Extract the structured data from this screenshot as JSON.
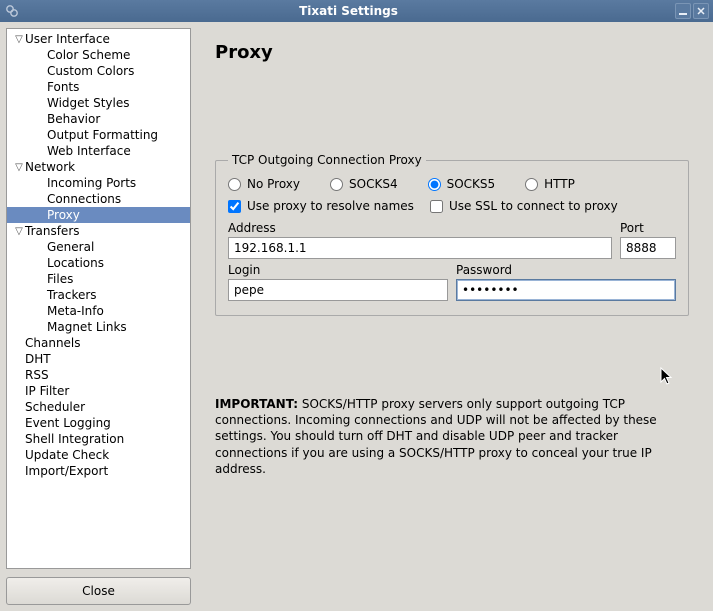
{
  "window": {
    "title": "Tixati Settings"
  },
  "sidebar": {
    "close_label": "Close",
    "items": [
      {
        "label": "User Interface",
        "depth": 0,
        "expander": "▽"
      },
      {
        "label": "Color Scheme",
        "depth": 1
      },
      {
        "label": "Custom Colors",
        "depth": 1
      },
      {
        "label": "Fonts",
        "depth": 1
      },
      {
        "label": "Widget Styles",
        "depth": 1
      },
      {
        "label": "Behavior",
        "depth": 1
      },
      {
        "label": "Output Formatting",
        "depth": 1
      },
      {
        "label": "Web Interface",
        "depth": 1
      },
      {
        "label": "Network",
        "depth": 0,
        "expander": "▽"
      },
      {
        "label": "Incoming Ports",
        "depth": 1
      },
      {
        "label": "Connections",
        "depth": 1
      },
      {
        "label": "Proxy",
        "depth": 1,
        "selected": true
      },
      {
        "label": "Transfers",
        "depth": 0,
        "expander": "▽"
      },
      {
        "label": "General",
        "depth": 1
      },
      {
        "label": "Locations",
        "depth": 1
      },
      {
        "label": "Files",
        "depth": 1
      },
      {
        "label": "Trackers",
        "depth": 1
      },
      {
        "label": "Meta-Info",
        "depth": 1
      },
      {
        "label": "Magnet Links",
        "depth": 1
      },
      {
        "label": "Channels",
        "depth": 0
      },
      {
        "label": "DHT",
        "depth": 0
      },
      {
        "label": "RSS",
        "depth": 0
      },
      {
        "label": "IP Filter",
        "depth": 0
      },
      {
        "label": "Scheduler",
        "depth": 0
      },
      {
        "label": "Event Logging",
        "depth": 0
      },
      {
        "label": "Shell Integration",
        "depth": 0
      },
      {
        "label": "Update Check",
        "depth": 0
      },
      {
        "label": "Import/Export",
        "depth": 0
      }
    ]
  },
  "content": {
    "heading": "Proxy",
    "group_legend": "TCP Outgoing Connection Proxy",
    "radios": {
      "no_proxy": "No Proxy",
      "socks4": "SOCKS4",
      "socks5": "SOCKS5",
      "http": "HTTP",
      "selected": "socks5"
    },
    "checks": {
      "resolve_label": "Use proxy to resolve names",
      "resolve_checked": true,
      "ssl_label": "Use SSL to connect to proxy",
      "ssl_checked": false
    },
    "fields": {
      "address_label": "Address",
      "address_value": "192.168.1.1",
      "port_label": "Port",
      "port_value": "8888",
      "login_label": "Login",
      "login_value": "pepe",
      "password_label": "Password",
      "password_value": "••••••••"
    },
    "important_label": "IMPORTANT:",
    "important_text": "SOCKS/HTTP proxy servers only support outgoing TCP connections. Incoming connections and UDP will not be affected by these settings. You should turn off DHT and disable UDP peer and tracker connections if you are using a SOCKS/HTTP proxy to conceal your true IP address."
  }
}
